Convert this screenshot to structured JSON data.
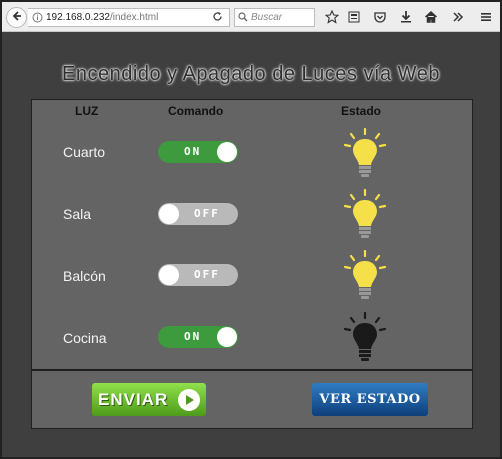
{
  "browser": {
    "url_host": "192.168.0.232",
    "url_path": "/index.html",
    "search_placeholder": "Buscar"
  },
  "page": {
    "title": "Encendido y Apagado de Luces vía Web",
    "headers": {
      "luz": "LUZ",
      "comando": "Comando",
      "estado": "Estado"
    },
    "rows": [
      {
        "room": "Cuarto",
        "toggle_label": "ON",
        "switch_on": true,
        "bulb_lit": true
      },
      {
        "room": "Sala",
        "toggle_label": "OFF",
        "switch_on": false,
        "bulb_lit": true
      },
      {
        "room": "Balcón",
        "toggle_label": "OFF",
        "switch_on": false,
        "bulb_lit": true
      },
      {
        "room": "Cocina",
        "toggle_label": "ON",
        "switch_on": true,
        "bulb_lit": false
      }
    ],
    "buttons": {
      "enviar": "ENVIAR",
      "ver_estado": "VER ESTADO"
    },
    "colors": {
      "toggle_on": "#3d9a3d",
      "toggle_off": "#b9b9b9",
      "bulb_lit": "#f6e04a",
      "bulb_off": "#1a1a1a"
    }
  }
}
